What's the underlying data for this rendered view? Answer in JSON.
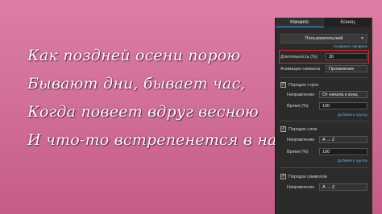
{
  "poem": {
    "lines": [
      "Как поздней осени порою",
      "Бывают дни, бывает час,",
      "Когда повеет вдруг весною",
      "И что-то встрепенется в нас,-"
    ]
  },
  "panel": {
    "tabs": [
      "Начало",
      "Конец"
    ],
    "preset_value": "Пользовательский",
    "preset_hint": "Сохранить профиль",
    "duration_label": "Длительность (%)",
    "duration_value": "30",
    "animation_label": "Анимация символа",
    "animation_value": "Проявление",
    "groups": [
      {
        "title": "Порядок строк",
        "direction_label": "Направление",
        "direction_value": "От начала к конц",
        "time_label": "Время (%)",
        "time_value": "100",
        "add_link": "Добавить группу"
      },
      {
        "title": "Порядок слов",
        "direction_label": "Направление",
        "direction_value": "A → Z",
        "time_label": "Время (%)",
        "time_value": "100",
        "add_link": "Добавить группу"
      },
      {
        "title": "Порядок символов",
        "direction_label": "Направление",
        "direction_value": "A → Z"
      }
    ]
  },
  "colors": {
    "background": "#d2709a",
    "panel": "#2b2b2b",
    "highlight": "#e0262b"
  }
}
